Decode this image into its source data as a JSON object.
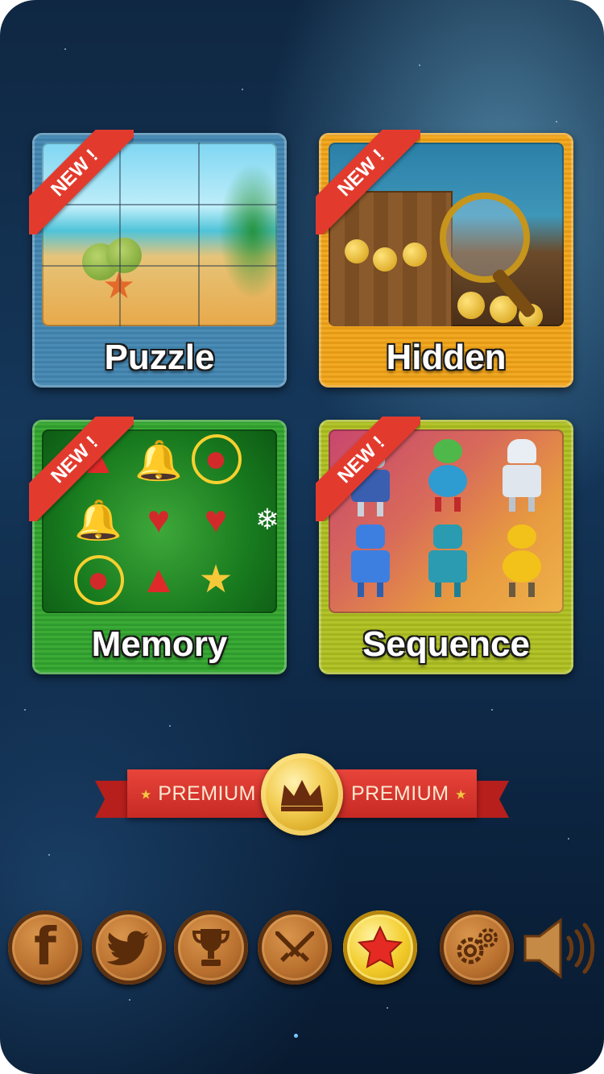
{
  "tiles": [
    {
      "label": "Puzzle",
      "badge": "NEW !"
    },
    {
      "label": "Hidden",
      "badge": "NEW !"
    },
    {
      "label": "Memory",
      "badge": "NEW !"
    },
    {
      "label": "Sequence",
      "badge": "NEW !"
    }
  ],
  "premium": {
    "left_text": "PREMIUM",
    "right_text": "PREMIUM"
  },
  "toolbar": {
    "buttons": [
      {
        "icon": "facebook-icon"
      },
      {
        "icon": "twitter-icon"
      },
      {
        "icon": "trophy-icon"
      },
      {
        "icon": "crossed-swords-icon"
      },
      {
        "icon": "star-icon"
      },
      {
        "icon": "settings-gears-icon"
      },
      {
        "icon": "speaker-icon"
      }
    ]
  },
  "colors": {
    "background": "#15375a",
    "puzzle_tile": "#4b8cb6",
    "hidden_tile": "#f2aa24",
    "memory_tile": "#3bab36",
    "sequence_tile": "#b3c42b",
    "ribbon": "#e23b2e",
    "wood": "#b86f2e",
    "gold": "#f2cc2a"
  }
}
